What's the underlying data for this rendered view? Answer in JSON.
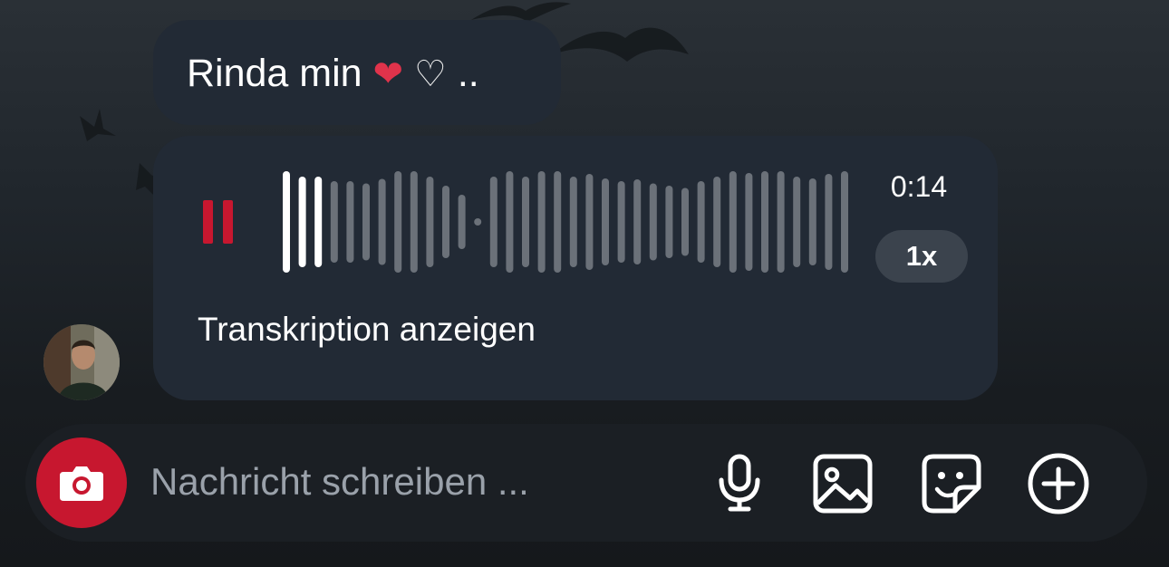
{
  "messages": [
    {
      "type": "text",
      "text": "Rinda min",
      "emojis": [
        "❤",
        "♡"
      ],
      "trailing": ".."
    },
    {
      "type": "voice",
      "state": "playing",
      "duration": "0:14",
      "speed": "1x",
      "progress": 0.08,
      "transcription_label": "Transkription anzeigen"
    }
  ],
  "avatar": {
    "icon": "user-avatar"
  },
  "composer": {
    "placeholder": "Nachricht schreiben ...",
    "icons": [
      "camera-icon",
      "microphone-icon",
      "image-icon",
      "sticker-icon",
      "plus-circle-icon"
    ]
  },
  "colors": {
    "accent": "#c7172f",
    "bubble": "#222a35",
    "wave_played": "#ffffff",
    "wave_unplayed": "#6b7179",
    "speed_pill": "#3b434d"
  }
}
